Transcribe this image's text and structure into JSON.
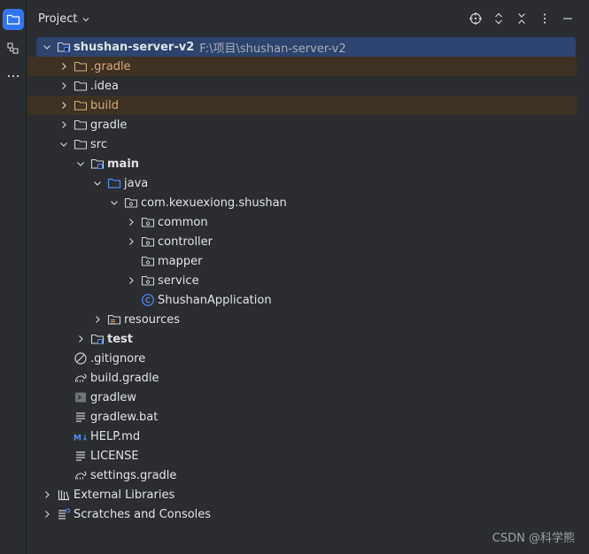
{
  "header": {
    "title": "Project"
  },
  "tree": [
    {
      "label": "shushan-server-v2",
      "path": "F:\\项目\\shushan-server-v2",
      "depth": 0,
      "chevron": "down",
      "icon": "module-folder-icon",
      "selected": true,
      "bold": true
    },
    {
      "label": ".gradle",
      "depth": 1,
      "chevron": "right",
      "icon": "folder-orange-icon",
      "excluded": true
    },
    {
      "label": ".idea",
      "depth": 1,
      "chevron": "right",
      "icon": "folder-icon"
    },
    {
      "label": "build",
      "depth": 1,
      "chevron": "right",
      "icon": "folder-orange-icon",
      "excluded": true
    },
    {
      "label": "gradle",
      "depth": 1,
      "chevron": "right",
      "icon": "folder-icon"
    },
    {
      "label": "src",
      "depth": 1,
      "chevron": "down",
      "icon": "folder-icon"
    },
    {
      "label": "main",
      "depth": 2,
      "chevron": "down",
      "icon": "module-folder-icon",
      "bold": true
    },
    {
      "label": "java",
      "depth": 3,
      "chevron": "down",
      "icon": "source-folder-icon"
    },
    {
      "label": "com.kexuexiong.shushan",
      "depth": 4,
      "chevron": "down",
      "icon": "package-icon"
    },
    {
      "label": "common",
      "depth": 5,
      "chevron": "right",
      "icon": "package-icon"
    },
    {
      "label": "controller",
      "depth": 5,
      "chevron": "right",
      "icon": "package-icon"
    },
    {
      "label": "mapper",
      "depth": 5,
      "chevron": "none",
      "icon": "package-icon"
    },
    {
      "label": "service",
      "depth": 5,
      "chevron": "right",
      "icon": "package-icon"
    },
    {
      "label": "ShushanApplication",
      "depth": 5,
      "chevron": "none",
      "icon": "class-icon"
    },
    {
      "label": "resources",
      "depth": 3,
      "chevron": "right",
      "icon": "resources-folder-icon"
    },
    {
      "label": "test",
      "depth": 2,
      "chevron": "right",
      "icon": "module-folder-icon",
      "bold": true
    },
    {
      "label": ".gitignore",
      "depth": 1,
      "chevron": "none",
      "icon": "ignore-file-icon"
    },
    {
      "label": "build.gradle",
      "depth": 1,
      "chevron": "none",
      "icon": "gradle-icon"
    },
    {
      "label": "gradlew",
      "depth": 1,
      "chevron": "none",
      "icon": "terminal-file-icon"
    },
    {
      "label": "gradlew.bat",
      "depth": 1,
      "chevron": "none",
      "icon": "text-file-icon"
    },
    {
      "label": "HELP.md",
      "depth": 1,
      "chevron": "none",
      "icon": "markdown-icon"
    },
    {
      "label": "LICENSE",
      "depth": 1,
      "chevron": "none",
      "icon": "text-file-icon"
    },
    {
      "label": "settings.gradle",
      "depth": 1,
      "chevron": "none",
      "icon": "gradle-icon"
    },
    {
      "label": "External Libraries",
      "depth": 0,
      "chevron": "right",
      "icon": "libraries-icon"
    },
    {
      "label": "Scratches and Consoles",
      "depth": 0,
      "chevron": "right",
      "icon": "scratches-icon"
    }
  ],
  "watermark": "CSDN @科学熊",
  "colors": {
    "selection": "#2e436e",
    "excluded": "#3d3223",
    "accent": "#3574f0",
    "background": "#2b2d30"
  }
}
